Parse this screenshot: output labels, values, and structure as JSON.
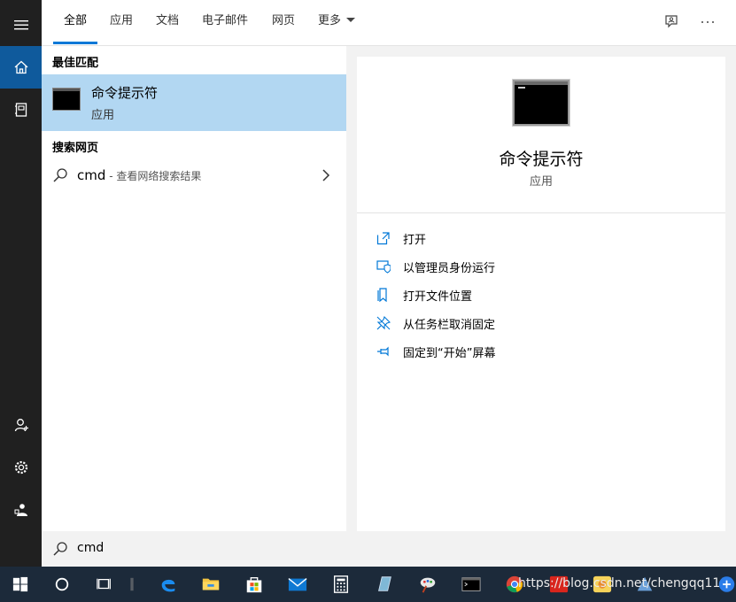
{
  "rail": {
    "top": [
      {
        "name": "hamburger-menu-icon",
        "active": false
      },
      {
        "name": "home-icon",
        "active": true
      },
      {
        "name": "notebook-icon",
        "active": false
      }
    ],
    "bottom": [
      {
        "name": "add-user-icon"
      },
      {
        "name": "gear-icon"
      },
      {
        "name": "feedback-user-icon"
      }
    ]
  },
  "tabs": [
    {
      "label": "全部",
      "active": true
    },
    {
      "label": "应用",
      "active": false
    },
    {
      "label": "文档",
      "active": false
    },
    {
      "label": "电子邮件",
      "active": false
    },
    {
      "label": "网页",
      "active": false
    },
    {
      "label": "更多",
      "active": false,
      "dropdown": true
    }
  ],
  "top_icons": [
    "feedback-icon",
    "more-options-icon"
  ],
  "results": {
    "best_match_label": "最佳匹配",
    "best_match": {
      "title": "命令提示符",
      "subtitle": "应用",
      "icon": "command-prompt-icon"
    },
    "web_label": "搜索网页",
    "web_query": "cmd",
    "web_hint": " - 查看网络搜索结果"
  },
  "detail": {
    "title": "命令提示符",
    "subtitle": "应用",
    "icon": "command-prompt-icon",
    "actions": [
      {
        "label": "打开",
        "icon": "open-icon"
      },
      {
        "label": "以管理员身份运行",
        "icon": "run-as-admin-icon"
      },
      {
        "label": "打开文件位置",
        "icon": "file-location-icon"
      },
      {
        "label": "从任务栏取消固定",
        "icon": "unpin-icon"
      },
      {
        "label": "固定到“开始”屏幕",
        "icon": "pin-icon"
      }
    ]
  },
  "search": {
    "value": "cmd"
  },
  "taskbar": {
    "items": [
      "windows-start-icon",
      "cortana-icon",
      "task-view-icon",
      "edge-icon",
      "file-explorer-icon",
      "store-icon",
      "mail-icon",
      "calculator-icon",
      "app-icon",
      "paint-icon",
      "command-prompt-icon",
      "chrome-icon",
      "app-icon",
      "app-icon",
      "app-icon"
    ],
    "watermark": "https://blog.csdn.net/chengqq116"
  },
  "colors": {
    "accent": "#0078d7",
    "selected": "#b2d7f2",
    "rail": "#202020",
    "rail_active": "#0f5a9c",
    "taskbar": "#1c2a3a"
  }
}
